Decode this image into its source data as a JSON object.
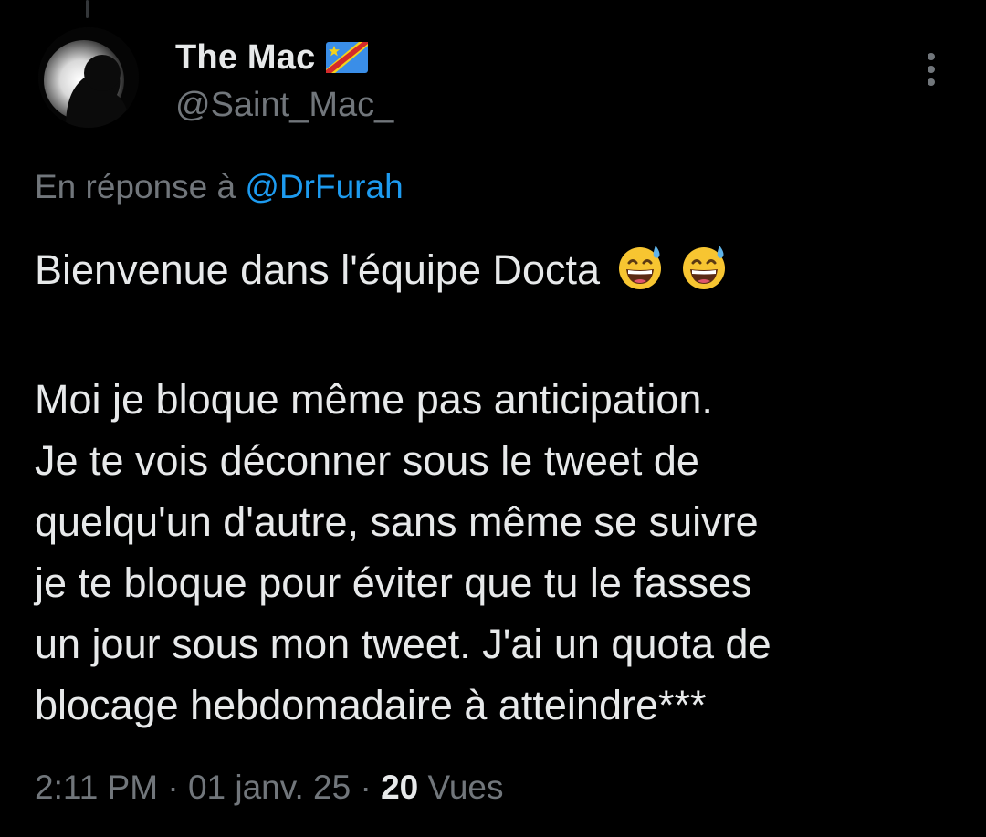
{
  "tweet": {
    "author": {
      "display_name": "The Mac",
      "handle": "@Saint_Mac_",
      "flag_icon": "drc-flag-icon"
    },
    "reply_context": {
      "prefix": "En réponse à",
      "mention": "@DrFurah"
    },
    "text_lines": {
      "l1": "Bienvenue dans l'équipe Docta",
      "l2": "Moi je bloque même pas anticipation.",
      "l3": "Je te vois déconner sous le tweet de",
      "l4": "quelqu'un d'autre, sans même se suivre",
      "l5": "je te bloque pour éviter que tu le fasses",
      "l6": "un jour sous mon tweet. J'ai un quota de",
      "l7": "blocage hebdomadaire à atteindre***"
    },
    "emojis": [
      "grinning-sweat-emoji",
      "grinning-sweat-emoji"
    ],
    "meta": {
      "time": "2:11 PM",
      "sep1": " · ",
      "date": "01 janv. 25",
      "sep2": " · ",
      "views_count": "20",
      "views_label": " Vues"
    }
  },
  "colors": {
    "background": "#000000",
    "text": "#e7e9ea",
    "secondary_text": "#71767b",
    "link": "#1d9bf0"
  }
}
